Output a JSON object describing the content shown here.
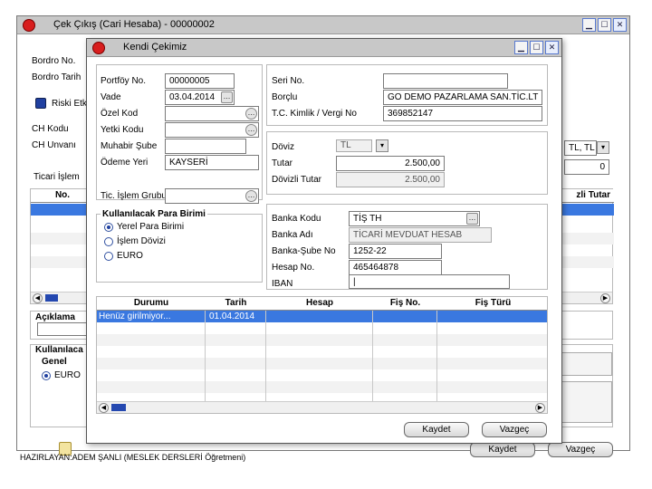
{
  "back_window": {
    "title": "Çek Çıkış (Cari Hesaba) - 00000002",
    "bordro_no_label": "Bordro No.",
    "bordro_tarih_label": "Bordro Tarih",
    "riski_label": "Riski Etk",
    "ch_kodu_label": "CH Kodu",
    "ch_unvani_label": "CH Unvanı",
    "ticari_islem_label": "Ticari İşlem",
    "grid_no_header": "No.",
    "grid_tutar_header": "zli Tutar",
    "currency_value": "TL, TL",
    "zero_value": "0",
    "aciklama_label": "Açıklama",
    "kullanilacak_label": "Kullanılaca",
    "genel_label": "Genel",
    "euro_label": "EURO",
    "kaydet_label": "Kaydet",
    "vazgec_label": "Vazgeç"
  },
  "front_window": {
    "title": "Kendi Çekimiz",
    "left": {
      "portfoy_no_label": "Portföy No.",
      "portfoy_no_value": "00000005",
      "vade_label": "Vade",
      "vade_value": "03.04.2014",
      "ozel_kod_label": "Özel Kod",
      "ozel_kod_value": "",
      "yetki_kodu_label": "Yetki Kodu",
      "yetki_kodu_value": "",
      "muhabir_sube_label": "Muhabir Şube",
      "muhabir_sube_value": "",
      "odeme_yeri_label": "Ödeme Yeri",
      "odeme_yeri_value": "KAYSERİ",
      "tic_islem_label": "Tic. İşlem Grubu",
      "tic_islem_value": ""
    },
    "right": {
      "seri_no_label": "Seri No.",
      "seri_no_value": "",
      "borclu_label": "Borçlu",
      "borclu_value": "GO DEMO PAZARLAMA SAN.TİC.LT",
      "tc_label": "T.C. Kimlik / Vergi No",
      "tc_value": "369852147"
    },
    "currency": {
      "doviz_label": "Döviz",
      "doviz_value": "TL",
      "tutar_label": "Tutar",
      "tutar_value": "2.500,00",
      "dovizli_tutar_label": "Dövizli Tutar",
      "dovizli_tutar_value": "2.500,00"
    },
    "para_birimi": {
      "title": "Kullanılacak Para Birimi",
      "options": [
        "Yerel Para Birimi",
        "İşlem Dövizi",
        "EURO"
      ],
      "selected_index": 0
    },
    "bank": {
      "banka_kodu_label": "Banka Kodu",
      "banka_kodu_value": "TİŞ   TH",
      "banka_adi_label": "Banka Adı",
      "banka_adi_value": "TİCARİ MEVDUAT HESAB",
      "banka_sube_label": "Banka-Şube No",
      "banka_sube_value": "1252-22",
      "hesap_no_label": "Hesap No.",
      "hesap_no_value": "465464878",
      "iban_label": "IBAN",
      "iban_value": "|"
    },
    "grid": {
      "columns": [
        "Durumu",
        "Tarih",
        "Hesap",
        "Fiş No.",
        "Fiş Türü"
      ],
      "rows": [
        [
          "Henüz girilmiyor...",
          "01.04.2014",
          "",
          "",
          ""
        ]
      ]
    },
    "kaydet_label": "Kaydet",
    "vazgec_label": "Vazgeç"
  },
  "footer_text": "HAZIRLAYAN:ADEM ŞANLI (MESLEK DERSLERİ Öğretmeni)"
}
